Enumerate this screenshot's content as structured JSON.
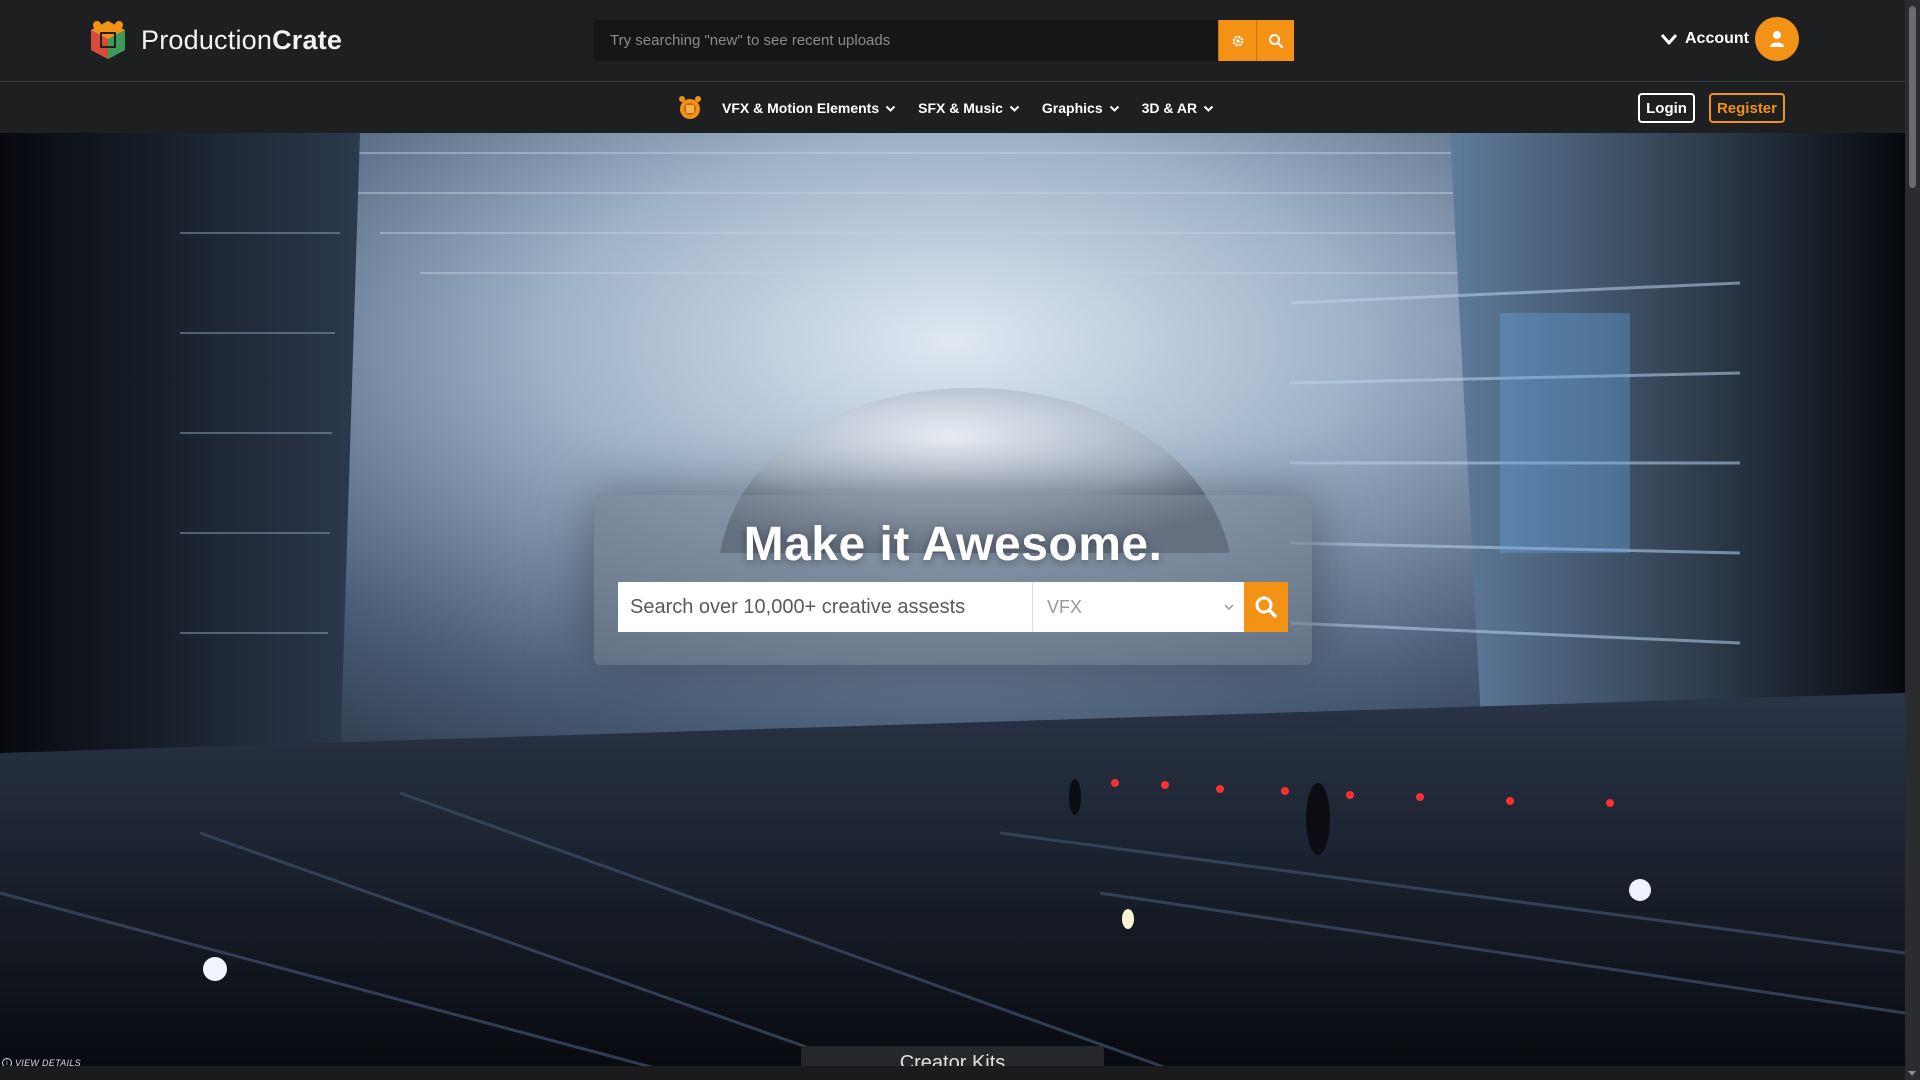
{
  "brand": {
    "name_light": "Production",
    "name_bold": "Crate"
  },
  "top_search": {
    "placeholder": "Try searching \"new\" to see recent uploads"
  },
  "icons": {
    "logo": "productioncrate-logo-icon",
    "settings": "gear-icon",
    "search": "search-icon",
    "chevron": "chevron-down-icon",
    "user": "user-icon",
    "info": "info-icon"
  },
  "account": {
    "label": "Account"
  },
  "nav": {
    "items": [
      {
        "label": "VFX & Motion Elements"
      },
      {
        "label": "SFX & Music"
      },
      {
        "label": "Graphics"
      },
      {
        "label": "3D & AR"
      }
    ],
    "login": "Login",
    "register": "Register"
  },
  "hero": {
    "title": "Make it Awesome.",
    "search_placeholder": "Search over 10,000+ creative assests",
    "category_selected": "VFX",
    "view_details": "VIEW DETAILS",
    "info_glyph": "i",
    "creator_kits": "Creator Kits"
  },
  "colors": {
    "accent": "#f39214",
    "bar": "#1e1f21"
  }
}
